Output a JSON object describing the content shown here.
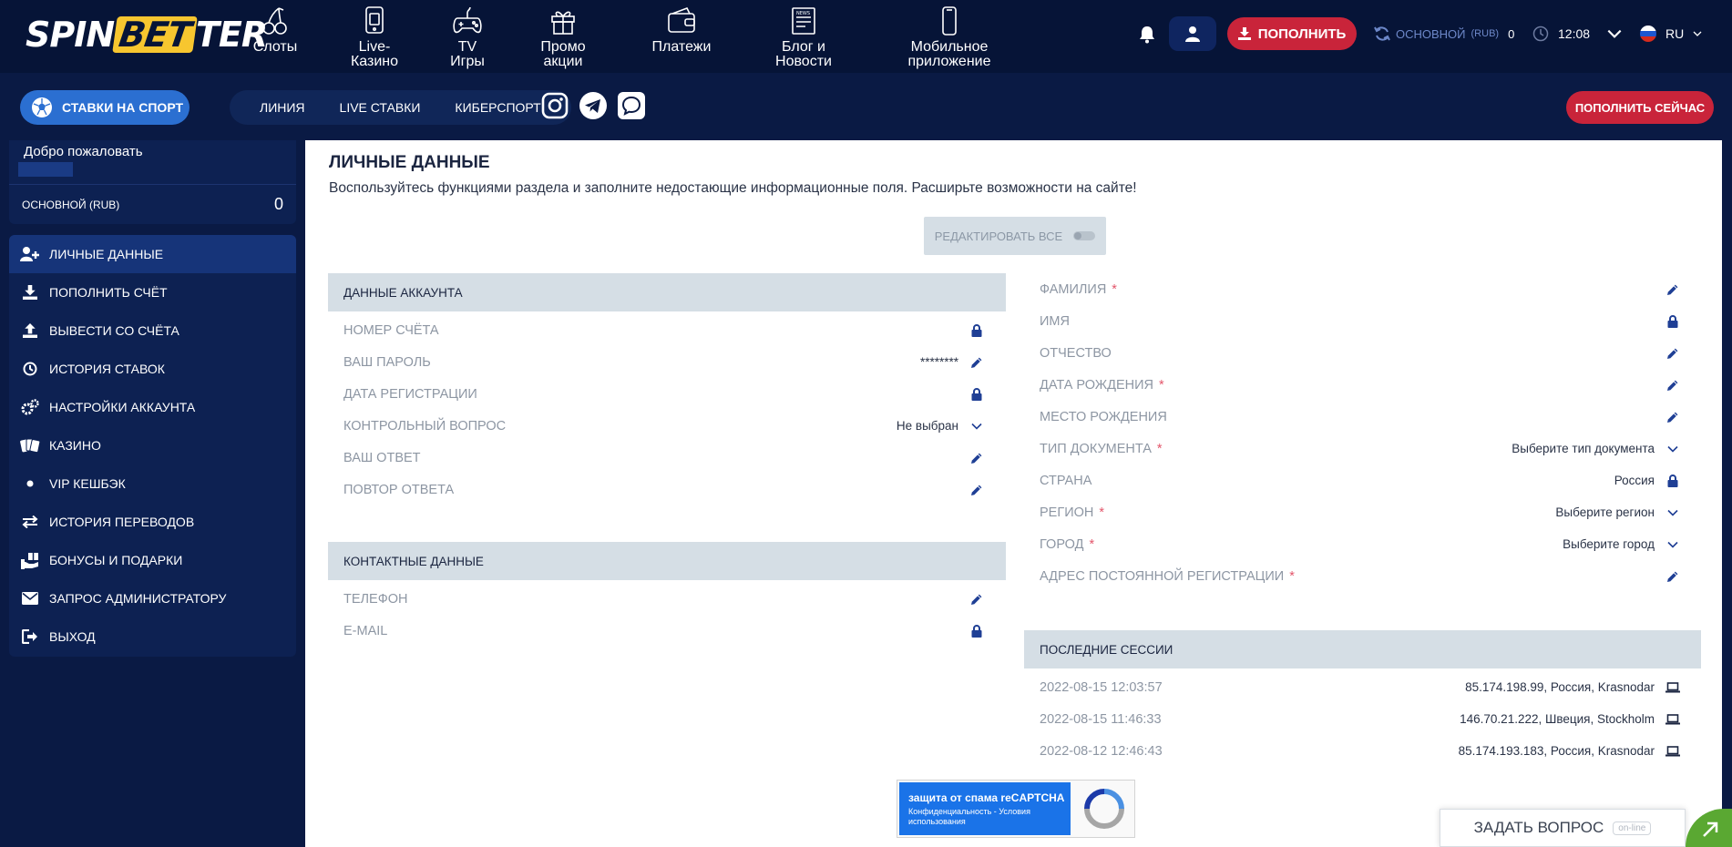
{
  "header": {
    "logo_left": "SPIN",
    "logo_mid": "BET",
    "logo_right": "TER",
    "nav": [
      {
        "label": "Слоты",
        "icon": "cherries-icon"
      },
      {
        "label": "Live-\nКазино",
        "icon": "phone-cards-icon"
      },
      {
        "label": "TV\nИгры",
        "icon": "gamepad-icon"
      },
      {
        "label": "Промо\nакции",
        "icon": "gift-icon"
      },
      {
        "label": "Платежи",
        "icon": "wallet-icon"
      },
      {
        "label": "Блог и\nНовости",
        "icon": "newspaper-icon"
      },
      {
        "label": "Мобильное\nприложение",
        "icon": "mobile-icon"
      }
    ],
    "deposit_label": "ПОПОЛНИТЬ",
    "balance_label": "ОСНОВНОЙ",
    "balance_currency": "(RUB)",
    "balance_value": "0",
    "time": "12:08",
    "lang": "RU"
  },
  "subbar": {
    "sport_label": "СТАВКИ НА СПОРТ",
    "links": [
      "ЛИНИЯ",
      "LIVE СТАВКИ",
      "КИБЕРСПОРТ"
    ],
    "deposit_now": "ПОПОЛНИТЬ СЕЙЧАС"
  },
  "sidebar": {
    "welcome": "Добро пожаловать",
    "balance_label": "ОСНОВНОЙ (RUB)",
    "balance_value": "0",
    "items": [
      {
        "label": "ЛИЧНЫЕ ДАННЫЕ",
        "icon": "user-plus-icon",
        "active": true
      },
      {
        "label": "ПОПОЛНИТЬ СЧЁТ",
        "icon": "download-icon"
      },
      {
        "label": "ВЫВЕСТИ СО СЧЁТА",
        "icon": "upload-icon"
      },
      {
        "label": "ИСТОРИЯ СТАВОК",
        "icon": "history-icon"
      },
      {
        "label": "НАСТРОЙКИ АККАУНТА",
        "icon": "gears-icon"
      },
      {
        "label": "КАЗИНО",
        "icon": "cards-icon"
      },
      {
        "label": "VIP КЕШБЭК",
        "icon": "dot-icon"
      },
      {
        "label": "ИСТОРИЯ ПЕРЕВОДОВ",
        "icon": "transfer-icon"
      },
      {
        "label": "БОНУСЫ И ПОДАРКИ",
        "icon": "gift-hand-icon"
      },
      {
        "label": "ЗАПРОС АДМИНИСТРАТОРУ",
        "icon": "envelope-icon"
      },
      {
        "label": "ВЫХОД",
        "icon": "logout-icon"
      }
    ]
  },
  "main": {
    "title": "ЛИЧНЫЕ ДАННЫЕ",
    "description": "Воспользуйтесь функциями раздела и заполните недостающие информационные поля. Расширьте возможности на сайте!",
    "edit_all": "РЕДАКТИРОВАТЬ ВСЕ",
    "account": {
      "heading": "ДАННЫЕ АККАУНТА",
      "rows": [
        {
          "label": "НОМЕР СЧЁТА",
          "value": "",
          "icon": "lock-icon"
        },
        {
          "label": "ВАШ ПАРОЛЬ",
          "value": "********",
          "icon": "pencil-icon"
        },
        {
          "label": "ДАТА РЕГИСТРАЦИИ",
          "value": "",
          "icon": "lock-icon"
        },
        {
          "label": "КОНТРОЛЬНЫЙ ВОПРОС",
          "value": "Не выбран",
          "icon": "chevron-down-icon"
        },
        {
          "label": "ВАШ ОТВЕТ",
          "value": "",
          "icon": "pencil-icon"
        },
        {
          "label": "ПОВТОР ОТВЕТА",
          "value": "",
          "icon": "pencil-icon"
        }
      ]
    },
    "contacts": {
      "heading": "КОНТАКТНЫЕ ДАННЫЕ",
      "rows": [
        {
          "label": "ТЕЛЕФОН",
          "value": "",
          "icon": "pencil-icon"
        },
        {
          "label": "E-MAIL",
          "value": "",
          "icon": "lock-icon"
        }
      ]
    },
    "personal": {
      "rows": [
        {
          "label": "ФАМИЛИЯ",
          "required": "*",
          "value": "",
          "icon": "pencil-icon"
        },
        {
          "label": "ИМЯ",
          "required": "",
          "value": "",
          "icon": "lock-icon"
        },
        {
          "label": "ОТЧЕСТВО",
          "required": "",
          "value": "",
          "icon": "pencil-icon"
        },
        {
          "label": "ДАТА РОЖДЕНИЯ",
          "required": "*",
          "value": "",
          "icon": "pencil-icon"
        },
        {
          "label": "МЕСТО РОЖДЕНИЯ",
          "required": "",
          "value": "",
          "icon": "pencil-icon"
        },
        {
          "label": "ТИП ДОКУМЕНТА",
          "required": "*",
          "value": "Выберите тип документа",
          "icon": "chevron-down-icon"
        },
        {
          "label": "СТРАНА",
          "required": "",
          "value": "Россия",
          "icon": "lock-icon"
        },
        {
          "label": "РЕГИОН",
          "required": "*",
          "value": "Выберите регион",
          "icon": "chevron-down-icon"
        },
        {
          "label": "ГОРОД",
          "required": "*",
          "value": "Выберите город",
          "icon": "chevron-down-icon"
        },
        {
          "label": "АДРЕС ПОСТОЯННОЙ РЕГИСТРАЦИИ",
          "required": "*",
          "value": "",
          "icon": "pencil-icon"
        }
      ]
    },
    "sessions": {
      "heading": "ПОСЛЕДНИЕ СЕССИИ",
      "rows": [
        {
          "time": "2022-08-15 12:03:57",
          "place": "85.174.198.99, Россия, Krasnodar"
        },
        {
          "time": "2022-08-15 11:46:33",
          "place": "146.70.21.222, Швеция, Stockholm"
        },
        {
          "time": "2022-08-12 12:46:43",
          "place": "85.174.193.183, Россия, Krasnodar"
        }
      ]
    },
    "captcha": {
      "title": "защита от спама reCAPTCHA",
      "links": "Конфиденциальность - Условия использования"
    }
  },
  "chat": {
    "label": "ЗАДАТЬ ВОПРОС",
    "status": "on-line"
  },
  "colors": {
    "header_bg": "#061437",
    "accent_red": "#c9243a",
    "accent_blue": "#2b6fd1",
    "logo_yellow": "#f7c62f",
    "icon_blue": "#1f3f95"
  }
}
